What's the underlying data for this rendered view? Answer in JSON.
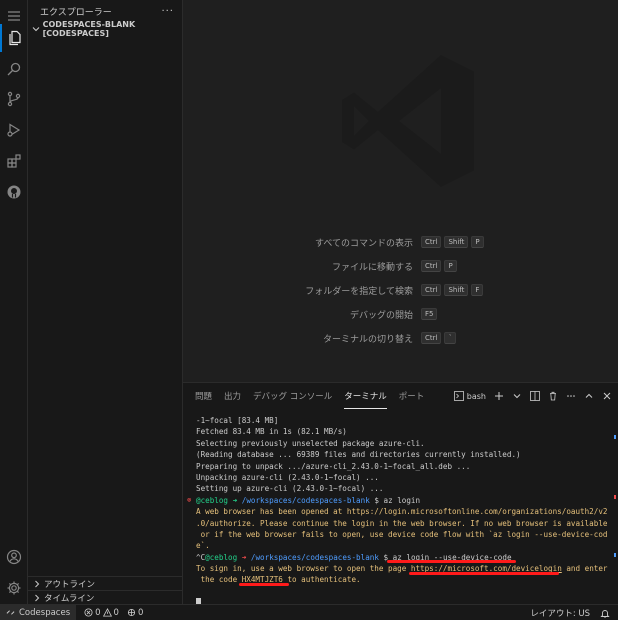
{
  "sidebar": {
    "title": "エクスプローラー",
    "more": "···",
    "workspace": "CODESPACES-BLANK [CODESPACES]",
    "outline": "アウトライン",
    "timeline": "タイムライン"
  },
  "activity": {
    "icons": [
      "explorer-icon",
      "search-icon",
      "source-control-icon",
      "run-debug-icon",
      "extensions-icon",
      "github-icon",
      "account-icon",
      "settings-gear-icon"
    ]
  },
  "editor": {
    "shortcuts": [
      {
        "label": "すべてのコマンドの表示",
        "keys": [
          "Ctrl",
          "Shift",
          "P"
        ]
      },
      {
        "label": "ファイルに移動する",
        "keys": [
          "Ctrl",
          "P"
        ]
      },
      {
        "label": "フォルダーを指定して検索",
        "keys": [
          "Ctrl",
          "Shift",
          "F"
        ]
      },
      {
        "label": "デバッグの開始",
        "keys": [
          "F5"
        ]
      },
      {
        "label": "ターミナルの切り替え",
        "keys": [
          "Ctrl",
          "`"
        ]
      }
    ]
  },
  "panel": {
    "tabs": [
      "問題",
      "出力",
      "デバッグ コンソール",
      "ターミナル",
      "ポート"
    ],
    "active_tab": "ターミナル",
    "terminal_name": "bash"
  },
  "terminal": {
    "lines": [
      "-1~focal [83.4 MB]",
      "Fetched 83.4 MB in 1s (82.1 MB/s)",
      "Selecting previously unselected package azure-cli.",
      "(Reading database ... 69389 files and directories currently installed.)",
      "Preparing to unpack .../azure-cli_2.43.0-1~focal_all.deb ...",
      "Unpacking azure-cli (2.43.0-1~focal) ...",
      "Setting up azure-cli (2.43.0-1~focal) ..."
    ],
    "prompt1": {
      "user": "@ceblog",
      "arrow": "➜",
      "path": "/workspaces/codespaces-blank",
      "dollar": "$",
      "command": "az login"
    },
    "msg1_line1": "A web browser has been opened at https://login.microsoftonline.com/organizations/oauth2/v2",
    "msg1_line2": ".0/authorize. Please continue the login in the web browser. If no web browser is available",
    "msg1_line3": " or if the web browser fails to open, use device code flow with `az login --use-device-cod",
    "msg1_line4": "e`.",
    "prompt2": {
      "prefix": "^C",
      "user": "@ceblog",
      "arrow": "➜",
      "path": "/workspaces/codespaces-blank",
      "dollar": "$",
      "command": "az login --use-device-code"
    },
    "msg2_a": "To sign in, use a web browser to open the page ",
    "msg2_url": "https://microsoft.com/devicelogin",
    "msg2_b": " and enter",
    "msg2_c": " the code ",
    "msg2_code": "HX4MTJZT6",
    "msg2_d": " to authenticate."
  },
  "status": {
    "remote": "Codespaces",
    "errors": "0",
    "warnings": "0",
    "ports": "0",
    "layout": "レイアウト: US"
  },
  "colors": {
    "accent": "#0078d4",
    "terminal_yellow": "#e5c07b",
    "prompt_green": "#23d18b",
    "path_blue": "#4f9dff",
    "annotation_red": "#ff1a1a"
  }
}
